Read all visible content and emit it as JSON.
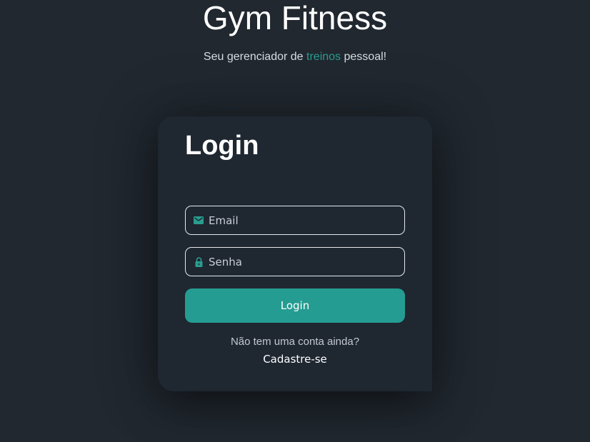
{
  "header": {
    "title": "Gym Fitness",
    "subtitle_before": "Seu gerenciador de ",
    "subtitle_accent": "treinos",
    "subtitle_after": " pessoal!"
  },
  "login_card": {
    "title": "Login",
    "email_placeholder": "Email",
    "email_icon": "mail-icon",
    "password_placeholder": "Senha",
    "password_icon": "lock-icon",
    "submit_label": "Login",
    "no_account_text": "Não tem uma conta ainda?",
    "signup_link": "Cadastre-se"
  },
  "colors": {
    "background": "#212830",
    "card": "#1f2731",
    "accent": "#2a9d8f",
    "button": "#249c91"
  }
}
